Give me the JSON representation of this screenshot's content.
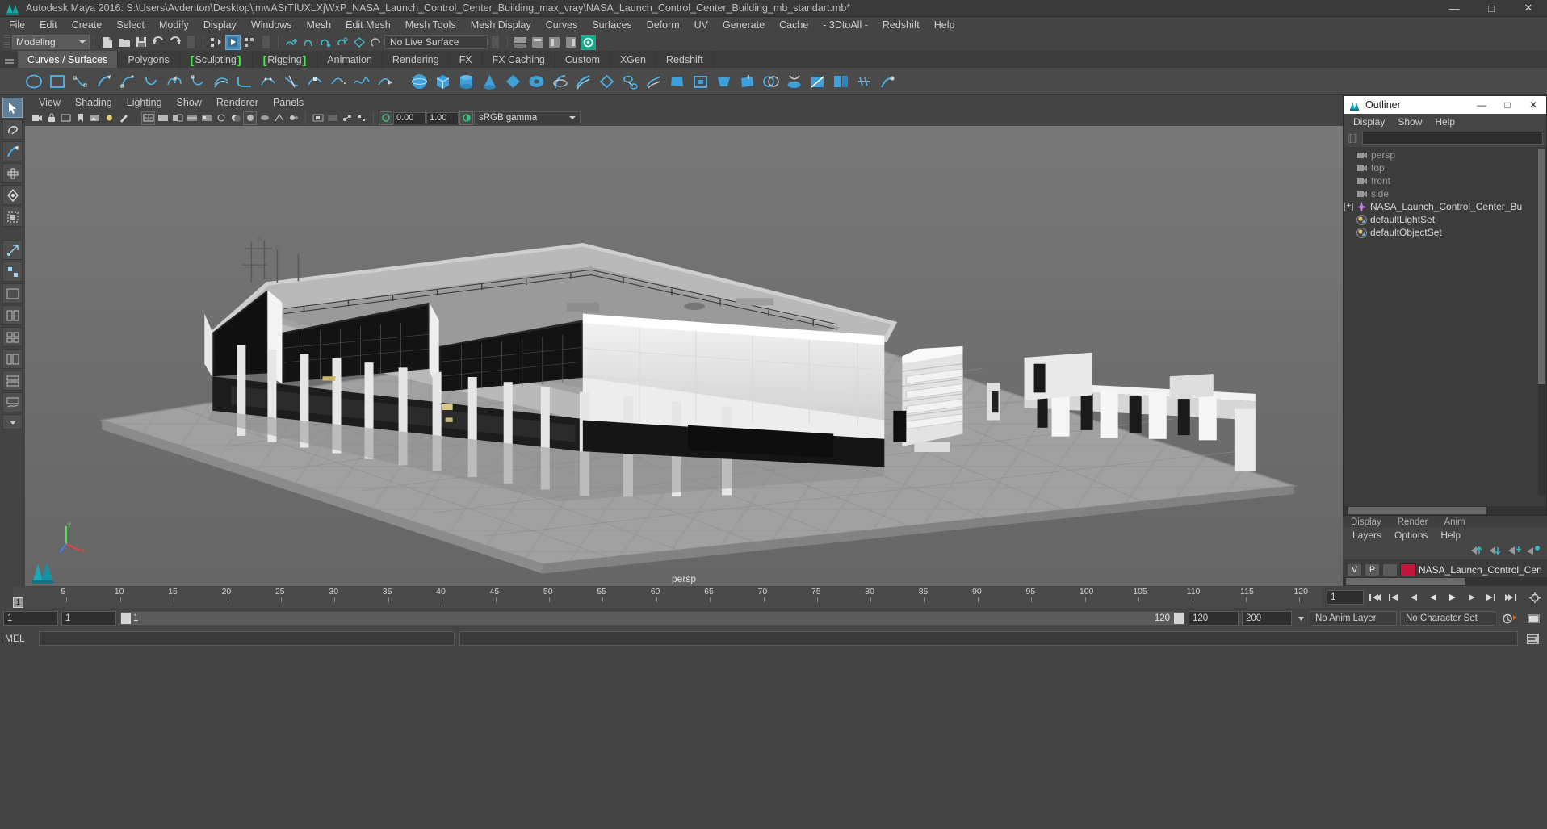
{
  "window": {
    "title": "Autodesk Maya 2016: S:\\Users\\Avdenton\\Desktop\\jmwASrTfUXLXjWxP_NASA_Launch_Control_Center_Building_max_vray\\NASA_Launch_Control_Center_Building_mb_standart.mb*",
    "minimize": "—",
    "maximize": "□",
    "close": "✕"
  },
  "menubar": {
    "items": [
      "File",
      "Edit",
      "Create",
      "Select",
      "Modify",
      "Display",
      "Windows",
      "Mesh",
      "Edit Mesh",
      "Mesh Tools",
      "Mesh Display",
      "Curves",
      "Surfaces",
      "Deform",
      "UV",
      "Generate",
      "Cache",
      "- 3DtoAll -",
      "Redshift",
      "Help"
    ]
  },
  "statusline": {
    "menuset": "Modeling",
    "live_surface": "No Live Surface"
  },
  "shelf": {
    "tabs": [
      {
        "label": "Curves / Surfaces",
        "active": true,
        "bracket": ""
      },
      {
        "label": "Polygons",
        "active": false,
        "bracket": ""
      },
      {
        "label": "Sculpting",
        "active": false,
        "bracket": "both"
      },
      {
        "label": "Rigging",
        "active": false,
        "bracket": "both"
      },
      {
        "label": "Animation",
        "active": false,
        "bracket": ""
      },
      {
        "label": "Rendering",
        "active": false,
        "bracket": ""
      },
      {
        "label": "FX",
        "active": false,
        "bracket": ""
      },
      {
        "label": "FX Caching",
        "active": false,
        "bracket": ""
      },
      {
        "label": "Custom",
        "active": false,
        "bracket": ""
      },
      {
        "label": "XGen",
        "active": false,
        "bracket": ""
      },
      {
        "label": "Redshift",
        "active": false,
        "bracket": ""
      }
    ]
  },
  "panelmenu": {
    "items": [
      "View",
      "Shading",
      "Lighting",
      "Show",
      "Renderer",
      "Panels"
    ]
  },
  "viewport": {
    "exposure": "0.00",
    "gamma": "1.00",
    "color_profile": "sRGB gamma",
    "camera_label": "persp",
    "axis": {
      "x": "x",
      "y": "y",
      "z": "z"
    }
  },
  "outliner": {
    "title": "Outliner",
    "menus": [
      "Display",
      "Show",
      "Help"
    ],
    "search_value": "",
    "items": [
      {
        "label": "persp",
        "icon": "camera-icon",
        "expandable": false,
        "dim": true
      },
      {
        "label": "top",
        "icon": "camera-icon",
        "expandable": false,
        "dim": true
      },
      {
        "label": "front",
        "icon": "camera-icon",
        "expandable": false,
        "dim": true
      },
      {
        "label": "side",
        "icon": "camera-icon",
        "expandable": false,
        "dim": true
      },
      {
        "label": "NASA_Launch_Control_Center_Bu",
        "icon": "transform-icon",
        "expandable": true,
        "dim": false
      },
      {
        "label": "defaultLightSet",
        "icon": "set-icon",
        "expandable": false,
        "dim": false
      },
      {
        "label": "defaultObjectSet",
        "icon": "set-icon",
        "expandable": false,
        "dim": false
      }
    ]
  },
  "layers": {
    "hidden_tabs": [
      "Display",
      "Render",
      "Anim"
    ],
    "menus": [
      "Layers",
      "Options",
      "Help"
    ],
    "rows": [
      {
        "visibility": "V",
        "playback": "P",
        "type": "",
        "color": "#c4163c",
        "name": "NASA_Launch_Control_Cen"
      }
    ]
  },
  "timeline": {
    "current_frame": "1",
    "current_frame_field": "1",
    "ticks": [
      "5",
      "10",
      "15",
      "20",
      "25",
      "30",
      "35",
      "40",
      "45",
      "50",
      "55",
      "60",
      "65",
      "70",
      "75",
      "80",
      "85",
      "90",
      "95",
      "100",
      "105",
      "110",
      "115",
      "120"
    ]
  },
  "range": {
    "start": "1",
    "end": "1",
    "range_start": "1",
    "range_end": "120",
    "playback_end": "120",
    "anim_end": "200",
    "anim_layer": "No Anim Layer",
    "character_set": "No Character Set"
  },
  "command": {
    "label": "MEL",
    "value": ""
  },
  "colors": {
    "accent_blue": "#4a8fc0",
    "shelf_green": "#2fff2f",
    "layer_red": "#c4163c",
    "panel_bg": "#444444",
    "viewport_bg": "#6e6e6e"
  }
}
